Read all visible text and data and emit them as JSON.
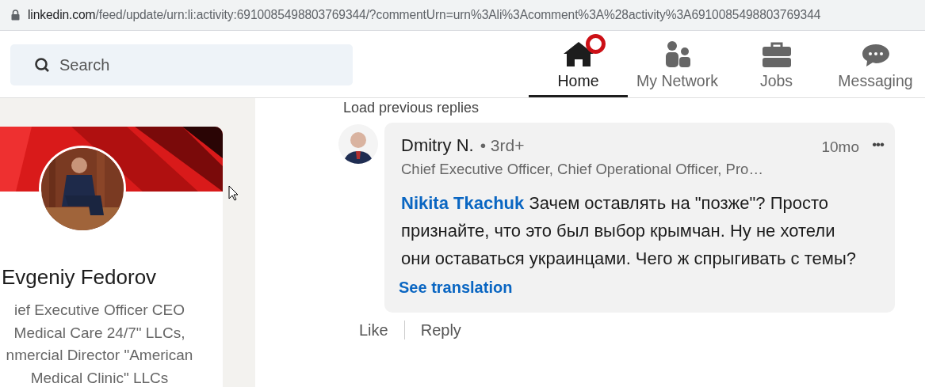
{
  "address_bar": {
    "domain": "linkedin.com",
    "path": "/feed/update/urn:li:activity:6910085498803769344/?commentUrn=urn%3Ali%3Acomment%3A%28activity%3A6910085498803769344"
  },
  "search": {
    "placeholder": "Search"
  },
  "nav": [
    {
      "label": "Home",
      "kind": "home",
      "selected": true,
      "notification": true
    },
    {
      "label": "My Network",
      "kind": "network",
      "selected": false,
      "notification": false
    },
    {
      "label": "Jobs",
      "kind": "jobs",
      "selected": false,
      "notification": false
    },
    {
      "label": "Messaging",
      "kind": "messaging",
      "selected": false,
      "notification": false
    }
  ],
  "profile_card": {
    "name": "Evgeniy Fedorov",
    "headline_lines": [
      "ief Executive Officer CEO",
      "Medical Care 24/7\" LLCs,",
      "nmercial Director \"American",
      "Medical Clinic\" LLCs"
    ]
  },
  "feed": {
    "load_more": "Load previous replies",
    "comment": {
      "author": "Dmitry N.",
      "degree": "• 3rd+",
      "time": "10mo",
      "more": "•••",
      "headline": "Chief Executive Officer, Chief Operational Officer, Pro…",
      "mention": "Nikita Tkachuk",
      "text": "Зачем оставлять на \"позже\"? Просто признайте, что это был выбор крымчан. Ну не хотели они оставаться украинцами. Чего ж спрыгивать с темы?",
      "translate": "See translation",
      "actions": [
        "Like",
        "Reply"
      ]
    }
  }
}
